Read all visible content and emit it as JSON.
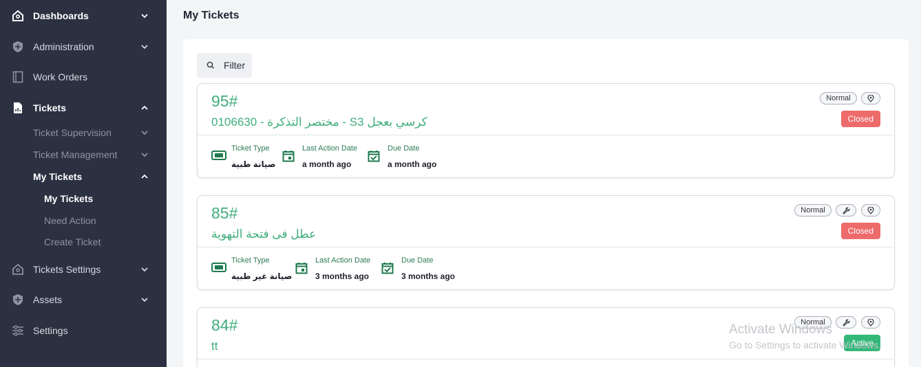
{
  "sidebar": {
    "items": [
      {
        "label": "Dashboards",
        "icon": "home-icon"
      },
      {
        "label": "Administration",
        "icon": "shield-icon"
      },
      {
        "label": "Work Orders",
        "icon": "document-icon"
      },
      {
        "label": "Tickets",
        "icon": "file-chart-icon"
      },
      {
        "label": "Tickets Settings",
        "icon": "home-settings-icon"
      },
      {
        "label": "Assets",
        "icon": "shield-icon"
      },
      {
        "label": "Settings",
        "icon": "sliders-icon"
      }
    ],
    "tickets_sub": [
      {
        "label": "Ticket Supervision"
      },
      {
        "label": "Ticket Management"
      },
      {
        "label": "My Tickets"
      }
    ],
    "my_tickets_sub": [
      {
        "label": "My Tickets"
      },
      {
        "label": "Need Action"
      },
      {
        "label": "Create Ticket"
      }
    ]
  },
  "page": {
    "title": "My Tickets",
    "filter_label": "Filter"
  },
  "meta_labels": {
    "type": "Ticket Type",
    "last_action": "Last Action Date",
    "due": "Due Date"
  },
  "tickets": [
    {
      "number": "95#",
      "subject": "مختصر التذكرة - 0106630 - S3 كرسي بعجل",
      "priority": "Normal",
      "status": "Closed",
      "type": "صيانة طبية",
      "last_action": "a month ago",
      "due": "a month ago"
    },
    {
      "number": "85#",
      "subject": "عطل فى فتحة التهوية",
      "priority": "Normal",
      "status": "Closed",
      "type": "صيانة غير طبية",
      "last_action": "3 months ago",
      "due": "3 months ago"
    },
    {
      "number": "84#",
      "subject": "tt",
      "priority": "Normal",
      "status": "Active"
    }
  ],
  "watermark": {
    "line1": "Activate Windows",
    "line2": "Go to Settings to activate Windows."
  },
  "colors": {
    "sidebar_bg": "#2c3142",
    "accent_green": "#3fae7c",
    "closed_red": "#ee6b6b",
    "active_green": "#33b878"
  }
}
